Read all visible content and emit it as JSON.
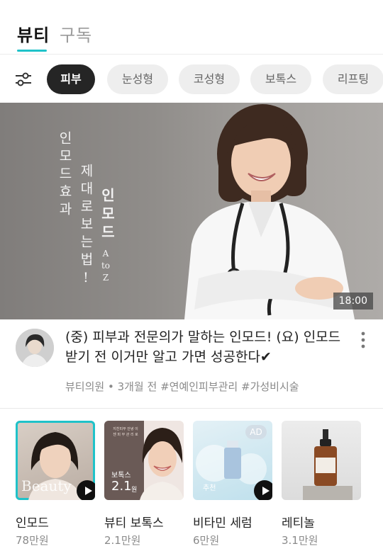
{
  "top_tabs": [
    {
      "label": "뷰티",
      "active": true
    },
    {
      "label": "구독",
      "active": false
    }
  ],
  "accent_color": "#1fc2c9",
  "filters": [
    "피부",
    "눈성형",
    "코성형",
    "보톡스",
    "리프팅"
  ],
  "hero": {
    "text_col1": "인모드효과",
    "text_col2": "제대로보는법!",
    "text_col3": "인모드",
    "text_col3_sub": "A to Z",
    "duration": "18:00"
  },
  "video": {
    "title": "(중) 피부과 전문의가 말하는 인모드! (요) 인모드 받기 전 이거만 알고 가면 성공한다✔",
    "meta": "뷰티의원 • 3개월 전  #연예인피부관리  #가성비시술"
  },
  "cards": [
    {
      "title": "인모드",
      "sub": "78만원",
      "overlay": "Beauty"
    },
    {
      "title": "뷰티 보톡스",
      "sub": "2.1만원",
      "badge": "보톡스",
      "price_overlay": "2.1",
      "overlay_small": "원",
      "overlay_text": "지친피부 안녕 이 젠 피 부 관 리 로"
    },
    {
      "title": "비타민 세럼",
      "sub": "6만원",
      "ad": "AD",
      "overlay": "추천"
    },
    {
      "title": "레티놀",
      "sub": "3.1만원"
    }
  ]
}
